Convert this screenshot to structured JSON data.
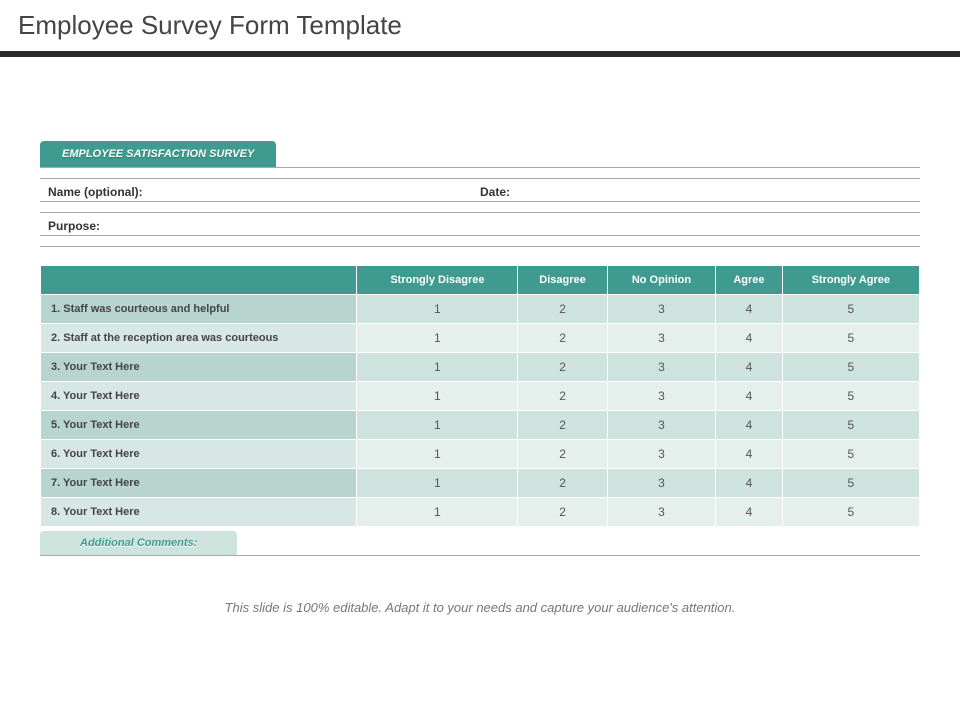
{
  "title": "Employee Survey Form Template",
  "tab_label": "EMPLOYEE SATISFACTION SURVEY",
  "fields": {
    "name_label": "Name (optional):",
    "date_label": "Date:",
    "purpose_label": "Purpose:"
  },
  "columns": [
    "Strongly Disagree",
    "Disagree",
    "No Opinion",
    "Agree",
    "Strongly Agree"
  ],
  "rows": [
    {
      "q": "1. Staff was courteous and helpful",
      "v": [
        "1",
        "2",
        "3",
        "4",
        "5"
      ]
    },
    {
      "q": "2. Staff at the reception area was courteous",
      "v": [
        "1",
        "2",
        "3",
        "4",
        "5"
      ]
    },
    {
      "q": "3. Your Text Here",
      "v": [
        "1",
        "2",
        "3",
        "4",
        "5"
      ]
    },
    {
      "q": "4. Your Text Here",
      "v": [
        "1",
        "2",
        "3",
        "4",
        "5"
      ]
    },
    {
      "q": "5. Your Text Here",
      "v": [
        "1",
        "2",
        "3",
        "4",
        "5"
      ]
    },
    {
      "q": "6. Your Text Here",
      "v": [
        "1",
        "2",
        "3",
        "4",
        "5"
      ]
    },
    {
      "q": "7. Your Text Here",
      "v": [
        "1",
        "2",
        "3",
        "4",
        "5"
      ]
    },
    {
      "q": "8. Your Text Here",
      "v": [
        "1",
        "2",
        "3",
        "4",
        "5"
      ]
    }
  ],
  "comments_label": "Additional Comments:",
  "footer": "This slide is 100% editable. Adapt it to your needs and capture your audience's attention."
}
